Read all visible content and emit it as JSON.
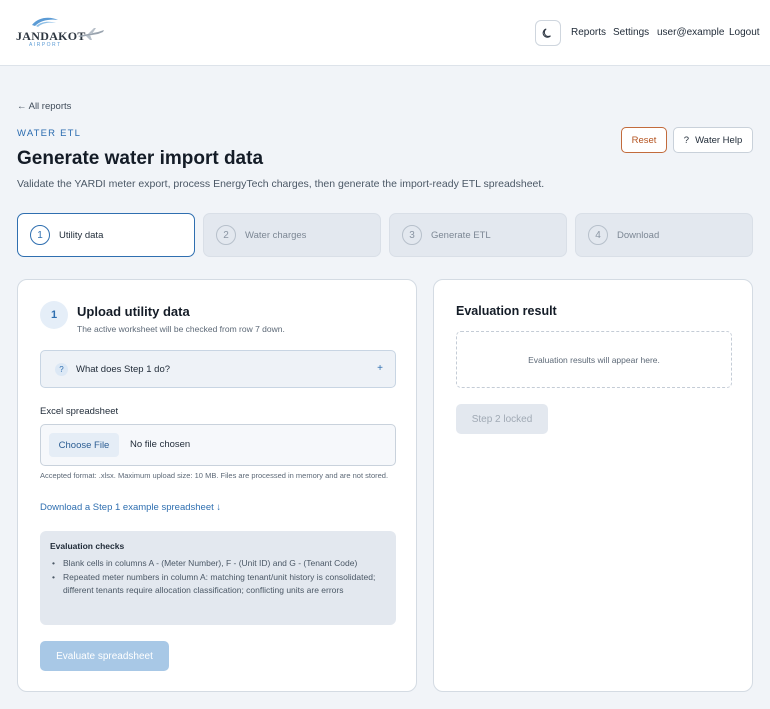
{
  "header": {
    "brand_name": "JANDAKOT",
    "brand_sub": "AIRPORT",
    "nav": {
      "reports": "Reports",
      "settings": "Settings",
      "user": "user@example",
      "logout": "Logout"
    }
  },
  "page": {
    "back_link": "← All reports",
    "eyebrow": "WATER ETL",
    "title": "Generate water import data",
    "description": "Validate the YARDI meter export, process EnergyTech charges, then generate the import-ready ETL spreadsheet.",
    "reset_label": "Reset",
    "help_icon": "?",
    "help_label": "Water Help"
  },
  "steps": [
    {
      "num": "1",
      "label": "Utility data",
      "active": true
    },
    {
      "num": "2",
      "label": "Water charges",
      "active": false
    },
    {
      "num": "3",
      "label": "Generate ETL",
      "active": false
    },
    {
      "num": "4",
      "label": "Download",
      "active": false
    }
  ],
  "upload": {
    "badge": "1",
    "title": "Upload utility data",
    "subtitle": "The active worksheet will be checked from row 7 down.",
    "faq_icon": "?",
    "faq_label": "What does Step 1 do?",
    "faq_toggle": "+",
    "field_label": "Excel spreadsheet",
    "choose_label": "Choose File",
    "no_file": "No file chosen",
    "accept_note": "Accepted format: .xlsx. Maximum upload size: 10 MB. Files are processed in memory and are not stored.",
    "example_link": "Download a Step 1 example spreadsheet ↓",
    "checks_title": "Evaluation checks",
    "checks": [
      "Blank cells in columns A - (Meter Number), F - (Unit ID) and G - (Tenant Code)",
      "Repeated meter numbers in column A: matching tenant/unit history is consolidated; different tenants require allocation classification; conflicting units are errors"
    ],
    "evaluate_label": "Evaluate spreadsheet"
  },
  "evaluation": {
    "title": "Evaluation result",
    "placeholder": "Evaluation results will appear here.",
    "step2_label": "Step 2 locked"
  },
  "colors": {
    "accent": "#2f6fb0",
    "reset": "#b4531f",
    "background": "#f1f4f8"
  }
}
